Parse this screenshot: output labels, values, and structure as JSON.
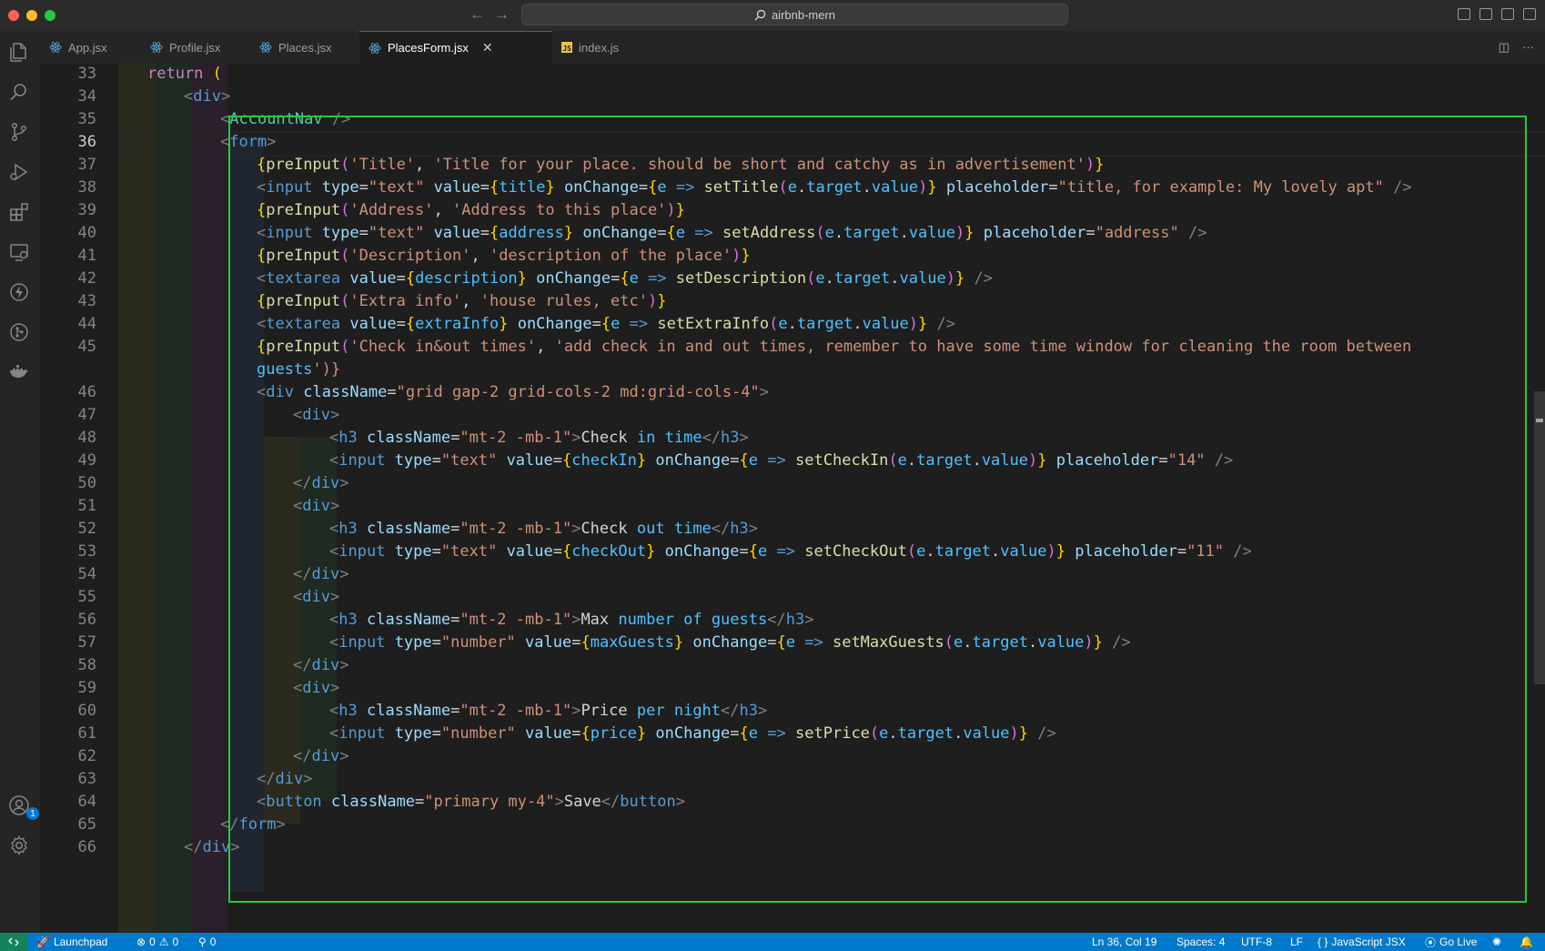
{
  "window": {
    "search_text": "airbnb-mern"
  },
  "tabs": [
    {
      "label": "App.jsx",
      "icon": "react-icon"
    },
    {
      "label": "Profile.jsx",
      "icon": "react-icon"
    },
    {
      "label": "Places.jsx",
      "icon": "react-icon"
    },
    {
      "label": "PlacesForm.jsx",
      "icon": "react-icon",
      "active": true
    },
    {
      "label": "index.js",
      "icon": "js-icon"
    }
  ],
  "line_numbers": [
    "33",
    "34",
    "35",
    "36",
    "37",
    "38",
    "39",
    "40",
    "41",
    "42",
    "43",
    "44",
    "45",
    "",
    "46",
    "47",
    "48",
    "49",
    "50",
    "51",
    "52",
    "53",
    "54",
    "55",
    "56",
    "57",
    "58",
    "59",
    "60",
    "61",
    "62",
    "63",
    "64",
    "65",
    "66"
  ],
  "current_line": "36",
  "code_lines": [
    "return (",
    "<div>",
    "<AccountNav />",
    "<form>",
    "{preInput('Title', 'Title for your place. should be short and catchy as in advertisement')}",
    "<input type=\"text\" value={title} onChange={e => setTitle(e.target.value)} placeholder=\"title, for example: My lovely apt\" />",
    "{preInput('Address', 'Address to this place')}",
    "<input type=\"text\" value={address} onChange={e => setAddress(e.target.value)} placeholder=\"address\" />",
    "{preInput('Description', 'description of the place')}",
    "<textarea value={description} onChange={e => setDescription(e.target.value)} />",
    "{preInput('Extra info', 'house rules, etc')}",
    "<textarea value={extraInfo} onChange={e => setExtraInfo(e.target.value)} />",
    "{preInput('Check in&out times', 'add check in and out times, remember to have some time window for cleaning the room between",
    "guests')}",
    "<div className=\"grid gap-2 grid-cols-2 md:grid-cols-4\">",
    "<div>",
    "<h3 className=\"mt-2 -mb-1\">Check in time</h3>",
    "<input type=\"text\" value={checkIn} onChange={e => setCheckIn(e.target.value)} placeholder=\"14\" />",
    "</div>",
    "<div>",
    "<h3 className=\"mt-2 -mb-1\">Check out time</h3>",
    "<input type=\"text\" value={checkOut} onChange={e => setCheckOut(e.target.value)} placeholder=\"11\" />",
    "</div>",
    "<div>",
    "<h3 className=\"mt-2 -mb-1\">Max number of guests</h3>",
    "<input type=\"number\" value={maxGuests} onChange={e => setMaxGuests(e.target.value)} />",
    "</div>",
    "<div>",
    "<h3 className=\"mt-2 -mb-1\">Price per night</h3>",
    "<input type=\"number\" value={price} onChange={e => setPrice(e.target.value)} />",
    "</div>",
    "</div>",
    "<button className=\"primary my-4\">Save</button>",
    "</form>",
    "</div>"
  ],
  "statusbar": {
    "launchpad": "Launchpad",
    "errors": "0",
    "warnings": "0",
    "ports": "0",
    "position": "Ln 36, Col 19",
    "spaces": "Spaces: 4",
    "encoding": "UTF-8",
    "eol": "LF",
    "language": "JavaScript JSX",
    "golive": "Go Live"
  },
  "accounts_badge": "1",
  "colors": {
    "accent": "#007acc",
    "highlight_box": "#28c840",
    "keyword": "#c586c0",
    "tag": "#569cd6",
    "string": "#ce9178",
    "function": "#dcdcaa",
    "attribute": "#9cdcfe"
  }
}
